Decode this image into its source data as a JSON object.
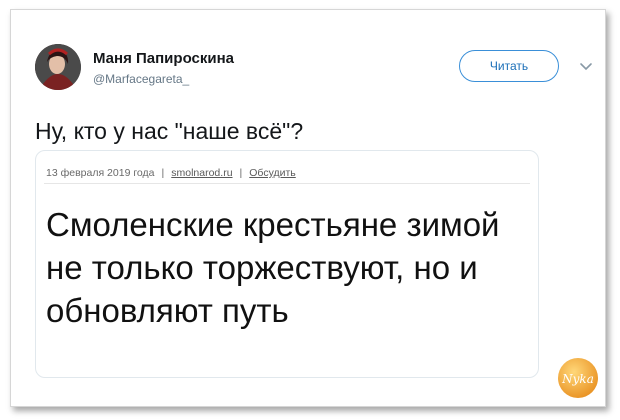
{
  "tweet": {
    "author_name": "Маня Папироскина",
    "author_handle": "@Marfacegareta_",
    "follow_label": "Читать",
    "text": "Ну, кто у нас \"наше всё\"?"
  },
  "embed": {
    "date": "13 февраля 2019 года",
    "separator": "|",
    "source": "smolnarod.ru",
    "discuss": "Обсудить",
    "headline": "Смоленские крестьяне зимой не только торжествуют, но и обновляют путь"
  },
  "watermark": {
    "text": "Nyka",
    "color": "#f0a020"
  },
  "colors": {
    "accent": "#1b6fb8",
    "text": "#14171a",
    "muted": "#657786"
  },
  "icons": [
    "avatar",
    "chevron-down-icon",
    "watermark-logo"
  ]
}
